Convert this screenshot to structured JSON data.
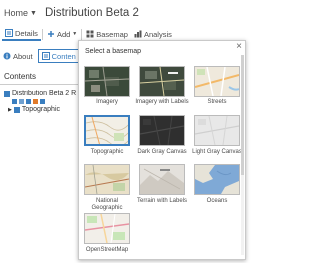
{
  "header": {
    "home": "Home",
    "title": "Distribution Beta 2"
  },
  "toolbar": {
    "details": "Details",
    "add": "Add",
    "basemap": "Basemap",
    "analysis": "Analysis"
  },
  "sidebar": {
    "tabs": {
      "about": "About",
      "content": "Conten"
    },
    "heading": "Contents",
    "layer": "Distribution Beta 2 R",
    "basemap_layer": "Topographic"
  },
  "gallery": {
    "title": "Select a basemap",
    "close": "×",
    "items": [
      {
        "label": "Imagery",
        "style": "imagery"
      },
      {
        "label": "Imagery with Labels",
        "style": "imagery-labels"
      },
      {
        "label": "Streets",
        "style": "streets"
      },
      {
        "label": "Topographic",
        "style": "topographic"
      },
      {
        "label": "Dark Gray Canvas",
        "style": "dark-gray"
      },
      {
        "label": "Light Gray Canvas",
        "style": "light-gray"
      },
      {
        "label": "National Geographic",
        "style": "natgeo"
      },
      {
        "label": "Terrain with Labels",
        "style": "terrain"
      },
      {
        "label": "Oceans",
        "style": "oceans"
      },
      {
        "label": "OpenStreetMap",
        "style": "osm"
      }
    ]
  },
  "colors": {
    "accent": "#3a7ebf"
  }
}
